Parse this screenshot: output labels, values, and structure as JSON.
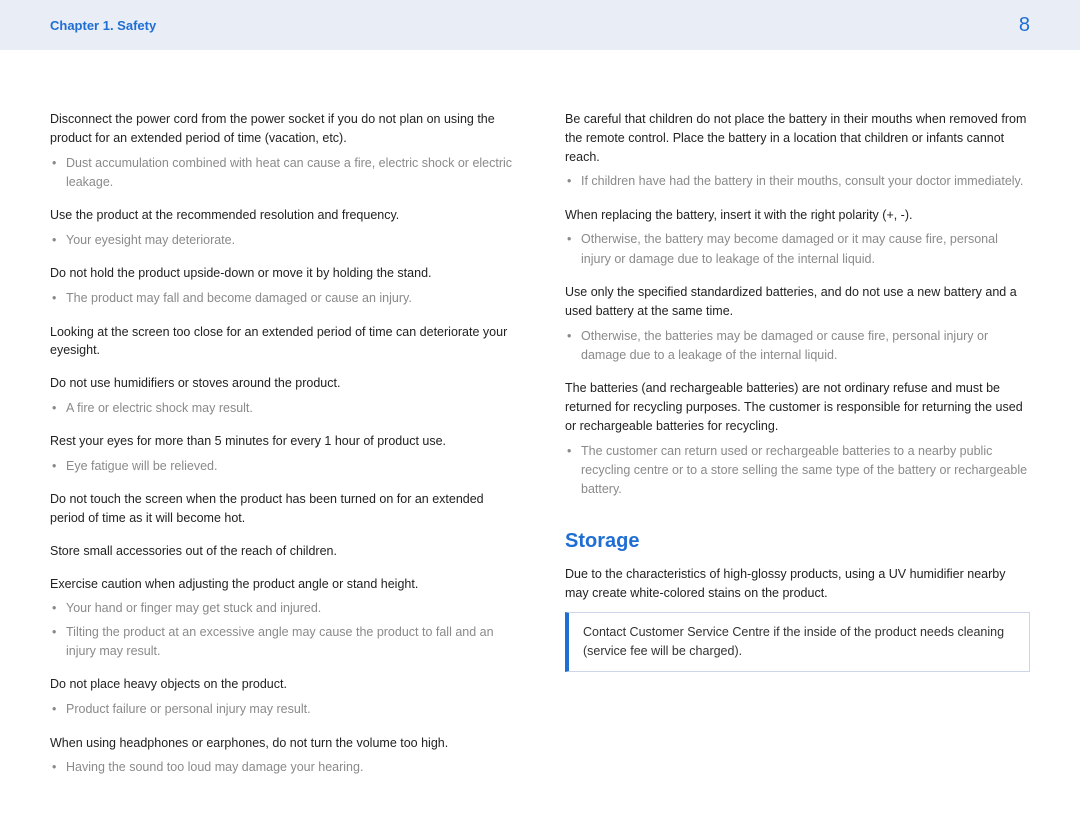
{
  "header": {
    "chapter": "Chapter 1. Safety",
    "page": "8"
  },
  "left": {
    "s1_para": "Disconnect the power cord from the power socket if you do not plan on using the product for an extended period of time (vacation, etc).",
    "s1_b1": "Dust accumulation combined with heat can cause a fire, electric shock or electric leakage.",
    "s2_para": "Use the product at the recommended resolution and frequency.",
    "s2_b1": "Your eyesight may deteriorate.",
    "s3_para": "Do not hold the product upside-down or move it by holding the stand.",
    "s3_b1": "The product may fall and become damaged or cause an injury.",
    "s4_para": "Looking at the screen too close for an extended period of time can deteriorate your eyesight.",
    "s5_para": "Do not use humidifiers or stoves around the product.",
    "s5_b1": "A fire or electric shock may result.",
    "s6_para": "Rest your eyes for more than 5 minutes for every 1 hour of product use.",
    "s6_b1": "Eye fatigue will be relieved.",
    "s7_para": "Do not touch the screen when the product has been turned on for an extended period of time as it will become hot.",
    "s8_para": "Store small accessories out of the reach of children.",
    "s9_para": "Exercise caution when adjusting the product angle or stand height.",
    "s9_b1": "Your hand or finger may get stuck and injured.",
    "s9_b2": "Tilting the product at an excessive angle may cause the product to fall and an injury may result.",
    "s10_para": "Do not place heavy objects on the product.",
    "s10_b1": "Product failure or personal injury may result.",
    "s11_para": "When using headphones or earphones, do not turn the volume too high.",
    "s11_b1": "Having the sound too loud may damage your hearing."
  },
  "right": {
    "r1_para": "Be careful that children do not place the battery in their mouths when removed from the remote control. Place the battery in a location that children or infants cannot reach.",
    "r1_b1": "If children have had the battery in their mouths, consult your doctor immediately.",
    "r2_para": "When replacing the battery, insert it with the right polarity (+, -).",
    "r2_b1": "Otherwise, the battery may become damaged or it may cause fire, personal injury or damage due to leakage of the internal liquid.",
    "r3_para": "Use only the specified standardized batteries, and do not use a new battery and a used battery at the same time.",
    "r3_b1": "Otherwise, the batteries may be damaged or cause fire, personal injury or damage due to a leakage of the internal liquid.",
    "r4_para": "The batteries (and rechargeable batteries) are not ordinary refuse and must be returned for recycling purposes. The customer is responsible for returning the used or rechargeable batteries for recycling.",
    "r4_b1": "The customer can return used or rechargeable batteries to a nearby public recycling centre or to a store selling the same type of the battery or rechargeable battery.",
    "storage_heading": "Storage",
    "storage_para": "Due to the characteristics of high-glossy products, using a UV humidifier nearby may create white-colored stains on the product.",
    "storage_note": "Contact Customer Service Centre if the inside of the product needs cleaning (service fee will be charged)."
  }
}
